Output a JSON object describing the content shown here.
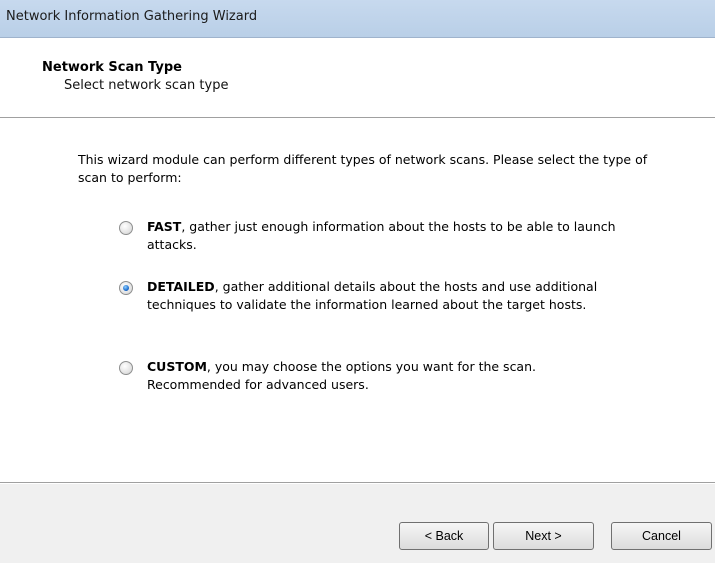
{
  "window": {
    "title": "Network Information Gathering Wizard"
  },
  "header": {
    "title": "Network Scan Type",
    "subtitle": "Select network scan type"
  },
  "body": {
    "intro": "This wizard module can perform different types of network scans. Please select the type of scan to perform:",
    "options": [
      {
        "keyword": "FAST",
        "text": ", gather just enough information about the hosts to be able to launch attacks.",
        "checked": false
      },
      {
        "keyword": "DETAILED",
        "text": ", gather additional details about the hosts and use additional techniques to validate the information learned about the target hosts.",
        "checked": true
      },
      {
        "keyword": "CUSTOM",
        "text": ", you may choose the options you want for the scan. Recommended for advanced users.",
        "checked": false
      }
    ]
  },
  "buttons": {
    "back": "< Back",
    "next": "Next >",
    "cancel": "Cancel"
  }
}
